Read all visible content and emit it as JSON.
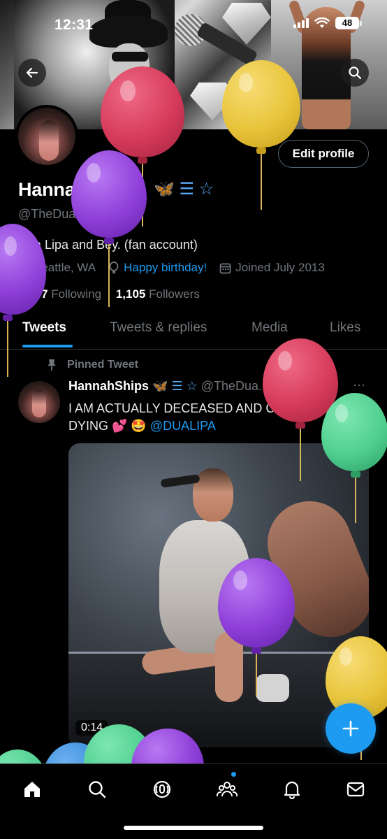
{
  "status_bar": {
    "time": "12:31",
    "battery": "48"
  },
  "profile": {
    "display_name": "HannahShips",
    "name_emojis": "🦋 ☰ ☆",
    "handle": "@TheDuaFan",
    "bio": "Dua Lipa and Bey. (fan account)",
    "location": "Seattle, WA",
    "website": "Happy birthday!",
    "joined": "Joined July 2013",
    "following_count": "1,797",
    "following_label": "Following",
    "followers_count": "1,105",
    "followers_label": "Followers",
    "edit_button": "Edit profile"
  },
  "tabs": [
    "Tweets",
    "Tweets & replies",
    "Media",
    "Likes"
  ],
  "tweet": {
    "pinned_label": "Pinned Tweet",
    "author": "HannahShips",
    "author_emojis": "🦋 ☰ ☆",
    "handle_date": "@TheDua... · 2/26/22",
    "more": "···",
    "text": "I AM ACTUALLY DECEASED AND CRYING AND DYING 💕 🤩",
    "mention": "@DUALIPA",
    "video_duration": "0:14"
  },
  "fab": {
    "icon": "plus-icon"
  },
  "bottom_nav": [
    "home-icon",
    "search-icon",
    "spaces-icon",
    "communities-icon",
    "notifications-icon",
    "messages-icon"
  ],
  "balloon_colors": {
    "red": "#d63a5a",
    "yellow": "#e8c43a",
    "purple": "#8f3fd9",
    "green": "#4fcf8f",
    "blue": "#3a8fe0"
  }
}
